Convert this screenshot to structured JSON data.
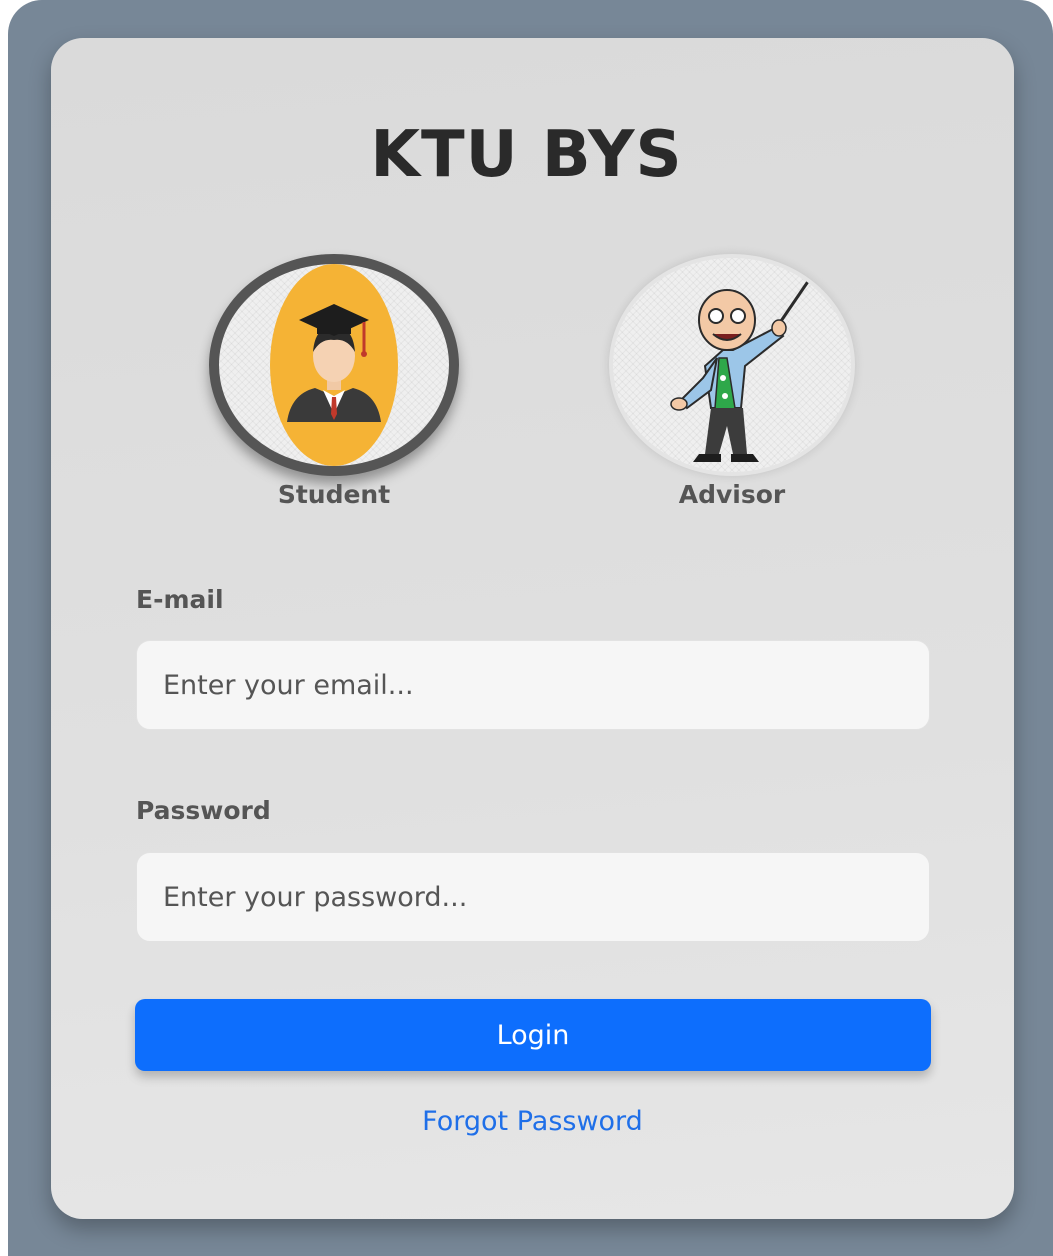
{
  "app": {
    "title": "KTU BYS"
  },
  "roles": [
    {
      "label": "Student",
      "icon": "graduate-student-icon",
      "selected": true
    },
    {
      "label": "Advisor",
      "icon": "professor-advisor-icon",
      "selected": false
    }
  ],
  "form": {
    "email_label": "E-mail",
    "email_placeholder": "Enter your email...",
    "email_value": "",
    "password_label": "Password",
    "password_placeholder": "Enter your password...",
    "password_value": "",
    "login_label": "Login",
    "forgot_label": "Forgot Password"
  },
  "colors": {
    "frame": "#778797",
    "card": "#dcdcdc",
    "primary": "#0d6efd",
    "link": "#1f6fe8",
    "selected_ring": "#555555"
  }
}
